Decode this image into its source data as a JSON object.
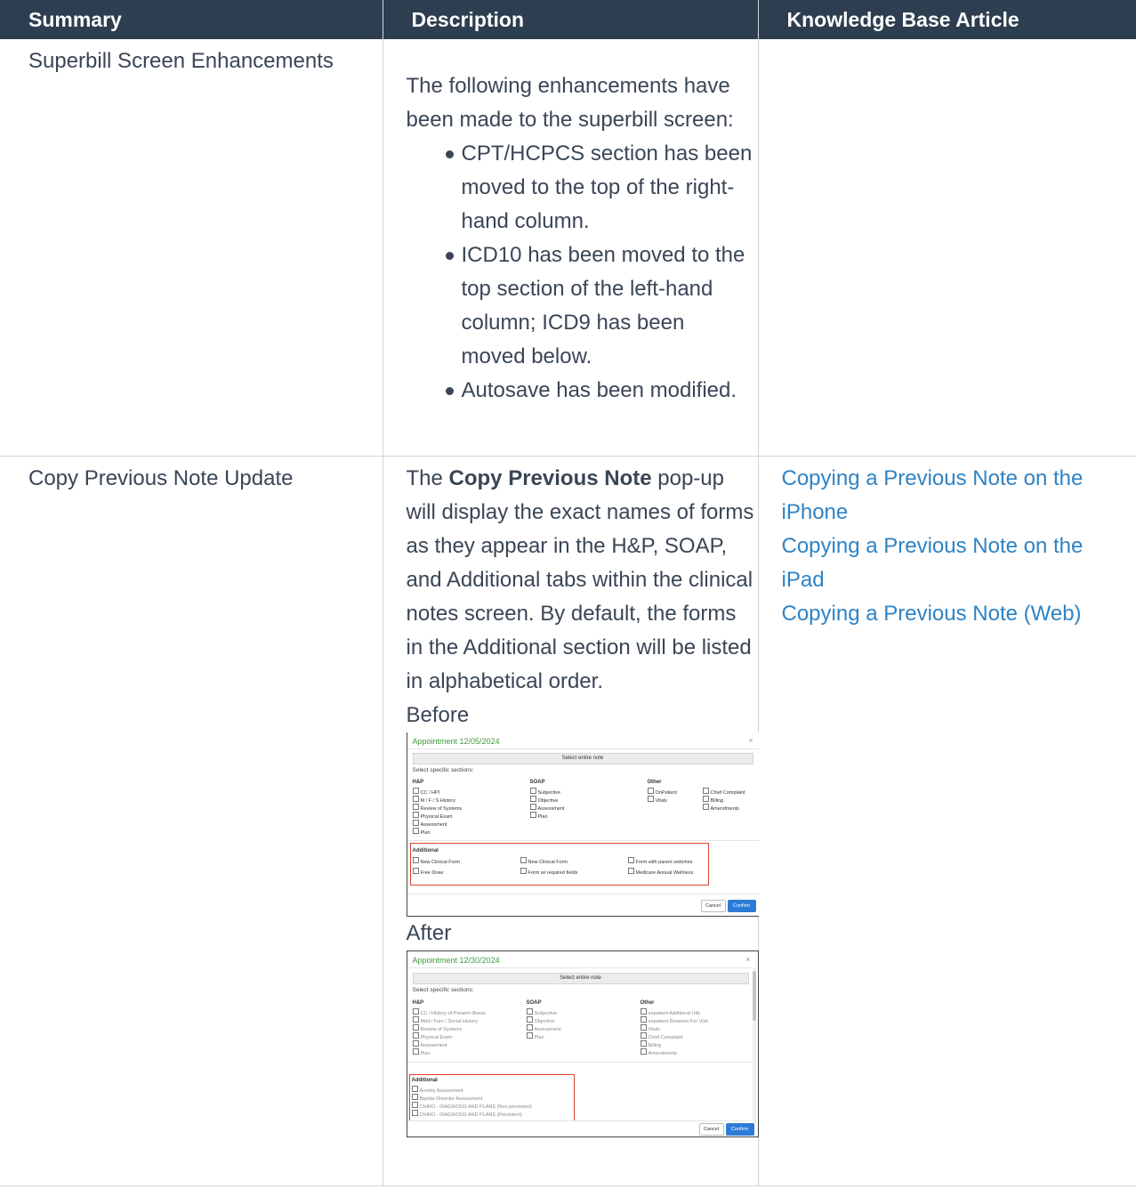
{
  "headers": [
    "Summary",
    "Description",
    "Knowledge Base Article"
  ],
  "row1": {
    "summary": "Superbill Screen Enhancements",
    "intro": "The following enhancements have been made to the superbill screen:",
    "bullets": [
      "CPT/HCPCS section has been moved to the top of the right-hand column.",
      "ICD10 has been moved to the top section of the left-hand column; ICD9 has been moved below.",
      "Autosave has been modified."
    ]
  },
  "row2": {
    "summary": "Copy Previous Note Update",
    "desc_pre": "The ",
    "desc_bold": "Copy Previous Note",
    "desc_post": " pop-up will display the exact names of forms as they appear in the H&P, SOAP, and Additional tabs within the clinical notes screen. By default, the forms in the Additional section will be listed in alphabetical order.",
    "before_label": "Before",
    "after_label": "After",
    "links": [
      "Copying a Previous Note on the iPhone",
      "Copying a Previous Note on the iPad",
      "Copying a Previous Note (Web)"
    ]
  },
  "shot_before": {
    "title": "Appointment 12/05/2024",
    "close": "×",
    "select_entire": "Select entire note",
    "select_specific": "Select specific sections:",
    "hp_heading": "H&P",
    "soap_heading": "SOAP",
    "other_heading": "Other",
    "hp_items": [
      "CC / HPI",
      "M / F / S History",
      "Review of Systems",
      "Physical Exam",
      "Assessment",
      "Plan"
    ],
    "soap_items": [
      "Subjective",
      "Objective",
      "Assessment",
      "Plan"
    ],
    "other_items_a": [
      "OnPatient",
      "Vitals"
    ],
    "other_items_b": [
      "Chief Complaint",
      "Billing",
      "Amendments"
    ],
    "additional_heading": "Additional",
    "additional_items": [
      "New Clinical Form",
      "New Clinical Form",
      "Form with parent switches",
      "Free Draw",
      "Form w/ required fields",
      "Medicare Annual Wellness"
    ],
    "cancel": "Cancel",
    "confirm": "Confirm"
  },
  "shot_after": {
    "title": "Appointment 12/30/2024",
    "close": "×",
    "select_entire": "Select entire note",
    "select_specific": "Select specific sections:",
    "hp_heading": "H&P",
    "soap_heading": "SOAP",
    "other_heading": "Other",
    "hp_items": [
      "CC / History of Present Illness",
      "Med / Fam / Social History",
      "Review of Systems",
      "Physical Exam",
      "Assessment",
      "Plan"
    ],
    "soap_items": [
      "Subjective",
      "Objective",
      "Assessment",
      "Plan"
    ],
    "other_items": [
      "onpatient Additional Info",
      "onpatient Reasons For Visit",
      "Vitals",
      "Chief Complaint",
      "Billing",
      "Amendments"
    ],
    "additional_heading": "Additional",
    "additional_items": [
      "Anxiety Assessment",
      "Bipolar Disorder Assessment",
      "CHIRO - DIAGNOSIS AND PLANS (Non persistent)",
      "CHIRO - DIAGNOSIS AND PLANS (Persistent)"
    ],
    "cancel": "Cancel",
    "confirm": "Confirm"
  }
}
